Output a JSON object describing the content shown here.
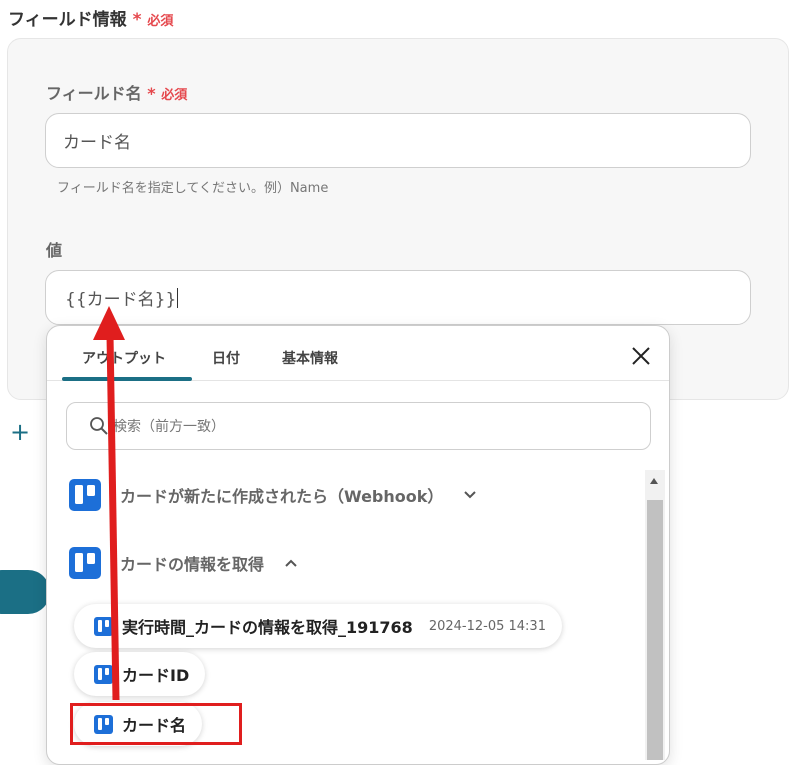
{
  "section": {
    "title": "フィールド情報",
    "required_star": "*",
    "required_text": "必須"
  },
  "field_name": {
    "label": "フィールド名",
    "required_star": "*",
    "required_text": "必須",
    "value": "カード名",
    "hint": "フィールド名を指定してください。例）Name"
  },
  "value_field": {
    "label": "値",
    "value": "{{カード名}}"
  },
  "popup": {
    "tabs": [
      "アウトプット",
      "日付",
      "基本情報"
    ],
    "active_tab": 0,
    "close_icon": "close-icon",
    "search_placeholder": "検索（前方一致）",
    "groups": [
      {
        "label": "カードが新たに作成されたら（Webhook）",
        "expanded": false,
        "icon": "trello-icon"
      },
      {
        "label": "カードの情報を取得",
        "expanded": true,
        "icon": "trello-icon"
      }
    ],
    "items": [
      {
        "label": "実行時間_カードの情報を取得_191768",
        "sub": "2024-12-05 14:31"
      },
      {
        "label": "カードID",
        "sub": ""
      },
      {
        "label": "カード名",
        "sub": ""
      }
    ]
  },
  "annotation_color": "#e01e1e",
  "accent_color": "#1b6f85"
}
